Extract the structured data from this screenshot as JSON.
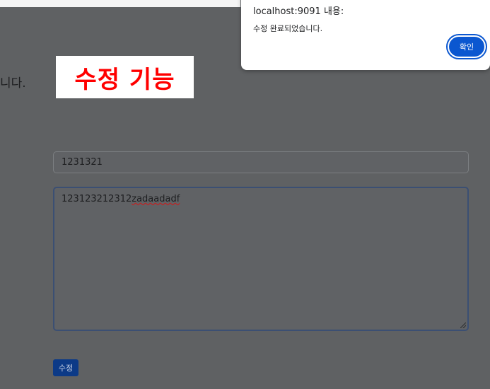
{
  "page": {
    "partial_heading": "니다.",
    "overlay_label": "수정 기능"
  },
  "form": {
    "title_value": "1231321",
    "content_prefix": "123123212312",
    "content_misspelled": "zadaadadf",
    "submit_label": "수정"
  },
  "dialog": {
    "origin": "localhost:9091 내용:",
    "message": "수정 완료되었습니다.",
    "ok_label": "확인"
  },
  "colors": {
    "accent": "#0b57d0",
    "overlay_text": "#ff0000"
  }
}
